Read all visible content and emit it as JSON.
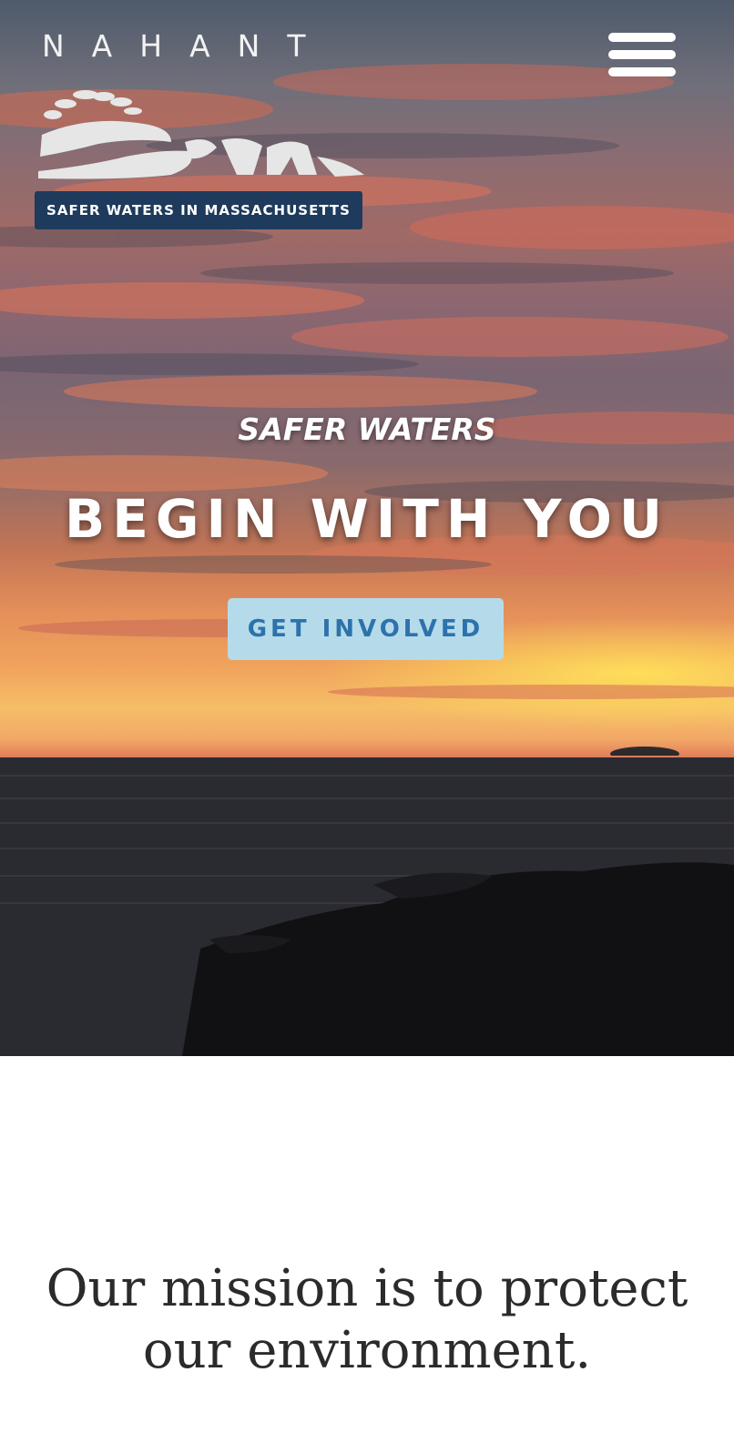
{
  "header": {
    "logo_wordmark": "NAHANT",
    "logo_swim_text": "Swim",
    "logo_tagline": "SAFER WATERS IN MASSACHUSETTS",
    "menu_icon": "hamburger-menu-icon"
  },
  "hero": {
    "kicker": "SAFER WATERS",
    "headline": "BEGIN WITH YOU",
    "cta_label": "GET INVOLVED"
  },
  "mission": {
    "text": "Our mission is to protect our environment."
  },
  "colors": {
    "band": "#1e3a5c",
    "cta_bg": "#b5dbea",
    "cta_text": "#2e72ac",
    "mission_text": "#2b2b2b"
  }
}
